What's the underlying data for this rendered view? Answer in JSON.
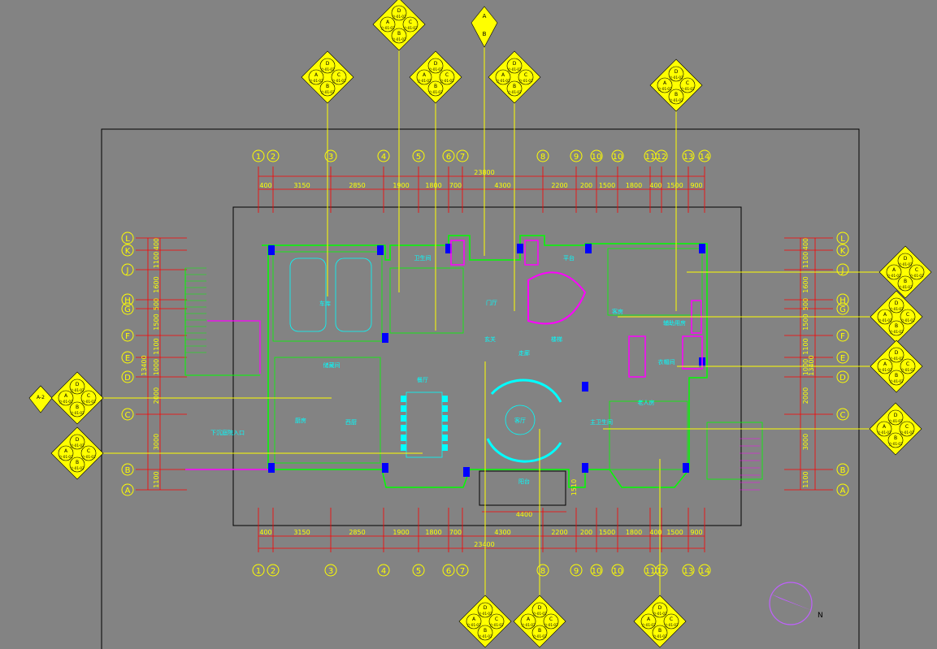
{
  "columns": {
    "top": [
      "1",
      "2",
      "3",
      "4",
      "5",
      "6",
      "7",
      "8",
      "9",
      "10",
      "10",
      "11",
      "12",
      "13",
      "14"
    ],
    "bottom": [
      "1",
      "2",
      "3",
      "4",
      "5",
      "6",
      "7",
      "8",
      "9",
      "10",
      "10",
      "11",
      "12",
      "13",
      "14"
    ]
  },
  "rows": {
    "left": [
      "L",
      "K",
      "J",
      "H",
      "G",
      "F",
      "E",
      "D",
      "C",
      "B",
      "A"
    ],
    "right": [
      "L",
      "K",
      "J",
      "H",
      "G",
      "F",
      "E",
      "D",
      "C",
      "B",
      "A"
    ]
  },
  "dimensions": {
    "top_segments": [
      "400",
      "3150",
      "2850",
      "1900",
      "1800",
      "700",
      "4300",
      "2200",
      "200",
      "1500",
      "1800",
      "400",
      "1500",
      "900"
    ],
    "top_total": "23800",
    "bottom_segments": [
      "400",
      "3150",
      "2850",
      "1900",
      "1800",
      "700",
      "4300",
      "2200",
      "200",
      "1500",
      "1800",
      "400",
      "1500",
      "900"
    ],
    "bottom_total": "23400",
    "left_segments": [
      "400",
      "1100",
      "1600",
      "500",
      "1500",
      "1100",
      "1000",
      "2000",
      "3000",
      "1100"
    ],
    "left_total": "13400",
    "right_segments": [
      "400",
      "1100",
      "1600",
      "500",
      "1500",
      "1100",
      "1000",
      "2000",
      "3000",
      "1100"
    ],
    "right_total": "13400",
    "balcony_width": "4400",
    "balcony_depth": "1510"
  },
  "rooms": {
    "garage": "车库",
    "kitchen": "厨房",
    "western_kitchen": "西厨",
    "dining": "餐厅",
    "living": "客厅",
    "entrance": "门厅",
    "foyer": "玄关",
    "hall": "走廊",
    "stair": "楼梯",
    "elder_room": "老人房",
    "guest_room": "客房",
    "bath_1": "卫生间",
    "bath_2": "主卫生间",
    "storage": "储藏间",
    "changing": "衣帽间",
    "balcony": "阳台",
    "aux": "辅助用房",
    "ramp": "下沉庭院入口",
    "terrace": "平台"
  },
  "elevation_tag_labels": {
    "letters": [
      "D",
      "A",
      "C",
      "B"
    ],
    "side_sheet": "立-01-02",
    "section_ref": "A-2"
  },
  "north_label": "N",
  "colors": {
    "background": "#838383",
    "grid_line": "#ffff00",
    "axis_line": "#ff0000",
    "wall_outline": "#00ff00",
    "column": "#0000ff",
    "furniture": "#00ffff",
    "stair": "#ff00ff",
    "border": "#000000",
    "tag_fill": "#ffff00"
  }
}
